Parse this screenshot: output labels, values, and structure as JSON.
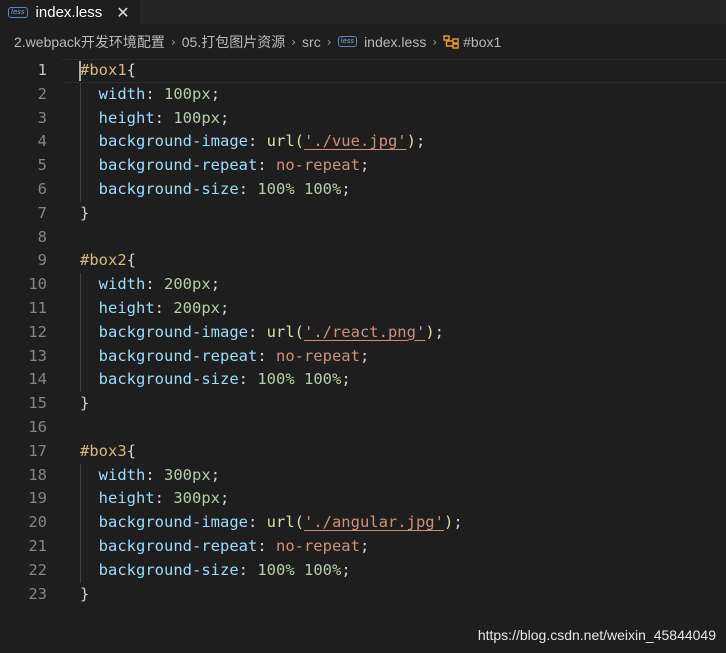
{
  "tab": {
    "icon": "less-file-icon",
    "badge": "less",
    "title": "index.less",
    "close": "✕"
  },
  "breadcrumb": {
    "folder": "2.webpack开发环境配置",
    "subfolder": "05.打包图片资源",
    "src": "src",
    "file_badge": "less",
    "file": "index.less",
    "symbol": "#box1",
    "separator": "›"
  },
  "editor": {
    "lines": [
      {
        "n": "1",
        "tokens": [
          [
            "sel",
            "#box1"
          ],
          [
            "brace",
            "{"
          ]
        ]
      },
      {
        "n": "2",
        "tokens": [
          [
            "sp",
            "  "
          ],
          [
            "prop",
            "width"
          ],
          [
            "punc",
            ": "
          ],
          [
            "num",
            "100px"
          ],
          [
            "punc",
            ";"
          ]
        ]
      },
      {
        "n": "3",
        "tokens": [
          [
            "sp",
            "  "
          ],
          [
            "prop",
            "height"
          ],
          [
            "punc",
            ": "
          ],
          [
            "num",
            "100px"
          ],
          [
            "punc",
            ";"
          ]
        ]
      },
      {
        "n": "4",
        "tokens": [
          [
            "sp",
            "  "
          ],
          [
            "prop",
            "background-image"
          ],
          [
            "punc",
            ": "
          ],
          [
            "fn",
            "url("
          ],
          [
            "str",
            "'./vue.jpg'"
          ],
          [
            "fn",
            ")"
          ],
          [
            "punc",
            ";"
          ]
        ]
      },
      {
        "n": "5",
        "tokens": [
          [
            "sp",
            "  "
          ],
          [
            "prop",
            "background-repeat"
          ],
          [
            "punc",
            ": "
          ],
          [
            "val",
            "no-repeat"
          ],
          [
            "punc",
            ";"
          ]
        ]
      },
      {
        "n": "6",
        "tokens": [
          [
            "sp",
            "  "
          ],
          [
            "prop",
            "background-size"
          ],
          [
            "punc",
            ": "
          ],
          [
            "num",
            "100%"
          ],
          [
            "punc",
            " "
          ],
          [
            "num",
            "100%"
          ],
          [
            "punc",
            ";"
          ]
        ]
      },
      {
        "n": "7",
        "tokens": [
          [
            "brace",
            "}"
          ]
        ]
      },
      {
        "n": "8",
        "tokens": []
      },
      {
        "n": "9",
        "tokens": [
          [
            "sel",
            "#box2"
          ],
          [
            "brace",
            "{"
          ]
        ]
      },
      {
        "n": "10",
        "tokens": [
          [
            "sp",
            "  "
          ],
          [
            "prop",
            "width"
          ],
          [
            "punc",
            ": "
          ],
          [
            "num",
            "200px"
          ],
          [
            "punc",
            ";"
          ]
        ]
      },
      {
        "n": "11",
        "tokens": [
          [
            "sp",
            "  "
          ],
          [
            "prop",
            "height"
          ],
          [
            "punc",
            ": "
          ],
          [
            "num",
            "200px"
          ],
          [
            "punc",
            ";"
          ]
        ]
      },
      {
        "n": "12",
        "tokens": [
          [
            "sp",
            "  "
          ],
          [
            "prop",
            "background-image"
          ],
          [
            "punc",
            ": "
          ],
          [
            "fn",
            "url("
          ],
          [
            "str",
            "'./react.png'"
          ],
          [
            "fn",
            ")"
          ],
          [
            "punc",
            ";"
          ]
        ]
      },
      {
        "n": "13",
        "tokens": [
          [
            "sp",
            "  "
          ],
          [
            "prop",
            "background-repeat"
          ],
          [
            "punc",
            ": "
          ],
          [
            "val",
            "no-repeat"
          ],
          [
            "punc",
            ";"
          ]
        ]
      },
      {
        "n": "14",
        "tokens": [
          [
            "sp",
            "  "
          ],
          [
            "prop",
            "background-size"
          ],
          [
            "punc",
            ": "
          ],
          [
            "num",
            "100%"
          ],
          [
            "punc",
            " "
          ],
          [
            "num",
            "100%"
          ],
          [
            "punc",
            ";"
          ]
        ]
      },
      {
        "n": "15",
        "tokens": [
          [
            "brace",
            "}"
          ]
        ]
      },
      {
        "n": "16",
        "tokens": []
      },
      {
        "n": "17",
        "tokens": [
          [
            "sel",
            "#box3"
          ],
          [
            "brace",
            "{"
          ]
        ]
      },
      {
        "n": "18",
        "tokens": [
          [
            "sp",
            "  "
          ],
          [
            "prop",
            "width"
          ],
          [
            "punc",
            ": "
          ],
          [
            "num",
            "300px"
          ],
          [
            "punc",
            ";"
          ]
        ]
      },
      {
        "n": "19",
        "tokens": [
          [
            "sp",
            "  "
          ],
          [
            "prop",
            "height"
          ],
          [
            "punc",
            ": "
          ],
          [
            "num",
            "300px"
          ],
          [
            "punc",
            ";"
          ]
        ]
      },
      {
        "n": "20",
        "tokens": [
          [
            "sp",
            "  "
          ],
          [
            "prop",
            "background-image"
          ],
          [
            "punc",
            ": "
          ],
          [
            "fn",
            "url("
          ],
          [
            "str",
            "'./angular.jpg'"
          ],
          [
            "fn",
            ")"
          ],
          [
            "punc",
            ";"
          ]
        ]
      },
      {
        "n": "21",
        "tokens": [
          [
            "sp",
            "  "
          ],
          [
            "prop",
            "background-repeat"
          ],
          [
            "punc",
            ": "
          ],
          [
            "val",
            "no-repeat"
          ],
          [
            "punc",
            ";"
          ]
        ]
      },
      {
        "n": "22",
        "tokens": [
          [
            "sp",
            "  "
          ],
          [
            "prop",
            "background-size"
          ],
          [
            "punc",
            ": "
          ],
          [
            "num",
            "100%"
          ],
          [
            "punc",
            " "
          ],
          [
            "num",
            "100%"
          ],
          [
            "punc",
            ";"
          ]
        ]
      },
      {
        "n": "23",
        "tokens": [
          [
            "brace",
            "}"
          ]
        ]
      }
    ],
    "active_line": "1"
  },
  "watermark": "https://blog.csdn.net/weixin_45844049",
  "colors": {
    "background": "#1e1e1e",
    "selector": "#d7ba7d",
    "property": "#9cdcfe",
    "number": "#b5cea8",
    "function": "#dcdcaa",
    "string": "#ce9178"
  }
}
